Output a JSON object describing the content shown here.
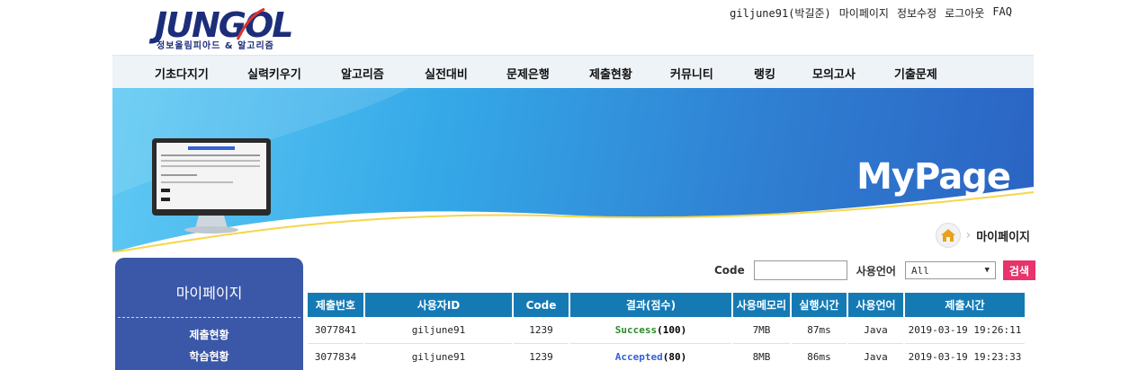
{
  "logo": {
    "text": "JUNGOL",
    "subtitle": "정보올림피아드 & 알고리즘"
  },
  "top_links": [
    "giljune91(박길준)",
    "마이페이지",
    "정보수정",
    "로그아웃",
    "FAQ"
  ],
  "nav": [
    "기초다지기",
    "실력키우기",
    "알고리즘",
    "실전대비",
    "문제은행",
    "제출현황",
    "커뮤니티",
    "랭킹",
    "모의고사",
    "기출문제"
  ],
  "banner": {
    "title": "MyPage"
  },
  "breadcrumb": {
    "current": "마이페이지"
  },
  "sidebar": {
    "title": "마이페이지",
    "items": [
      "제출현황",
      "학습현황"
    ]
  },
  "filter": {
    "code_label": "Code",
    "code_value": "",
    "lang_label": "사용언어",
    "lang_selected": "All",
    "search_label": "검색"
  },
  "table": {
    "headers": [
      "제출번호",
      "사용자ID",
      "Code",
      "결과(점수)",
      "사용메모리",
      "실행시간",
      "사용언어",
      "제출시간"
    ],
    "rows": [
      {
        "id": "3077841",
        "user": "giljune91",
        "code": "1239",
        "result": "Success",
        "score": "(100)",
        "result_type": "success",
        "memory": "7MB",
        "time": "87ms",
        "lang": "Java",
        "submitted": "2019-03-19 19:26:11"
      },
      {
        "id": "3077834",
        "user": "giljune91",
        "code": "1239",
        "result": "Accepted",
        "score": "(80)",
        "result_type": "accepted",
        "memory": "8MB",
        "time": "86ms",
        "lang": "Java",
        "submitted": "2019-03-19 19:23:33"
      }
    ]
  },
  "colors": {
    "nav_bg": "#eef3f8",
    "sidebar_bg": "#3a57a8",
    "table_header": "#157ab4",
    "search_button": "#e8336b",
    "success": "#2c8a2c",
    "accepted": "#3461d6",
    "metric_red": "#d21d1d"
  }
}
